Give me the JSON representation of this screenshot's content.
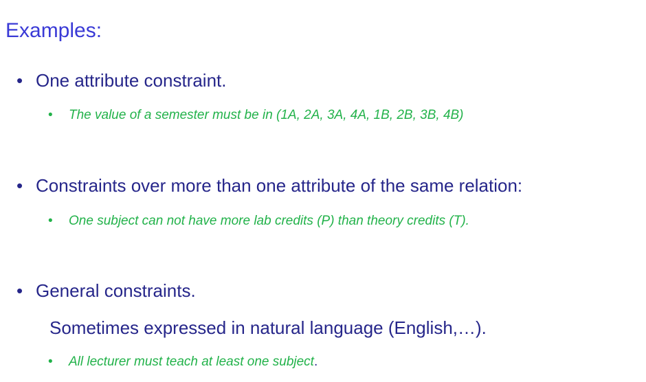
{
  "title": "Examples:",
  "bullet_char": "•",
  "items": [
    {
      "text": "One attribute constraint.",
      "sub": "The value of a semester must be in (1A, 2A, 3A, 4A, 1B, 2B, 3B, 4B)"
    },
    {
      "text": "Constraints over more than one attribute of the same relation:",
      "sub": "One subject can not have more lab credits (P) than theory credits (T)."
    },
    {
      "text": "General constraints.",
      "note": "Sometimes expressed in natural language (English,…).",
      "sub": "All lecturer must teach at least one subject",
      "sub_tail": "."
    }
  ]
}
